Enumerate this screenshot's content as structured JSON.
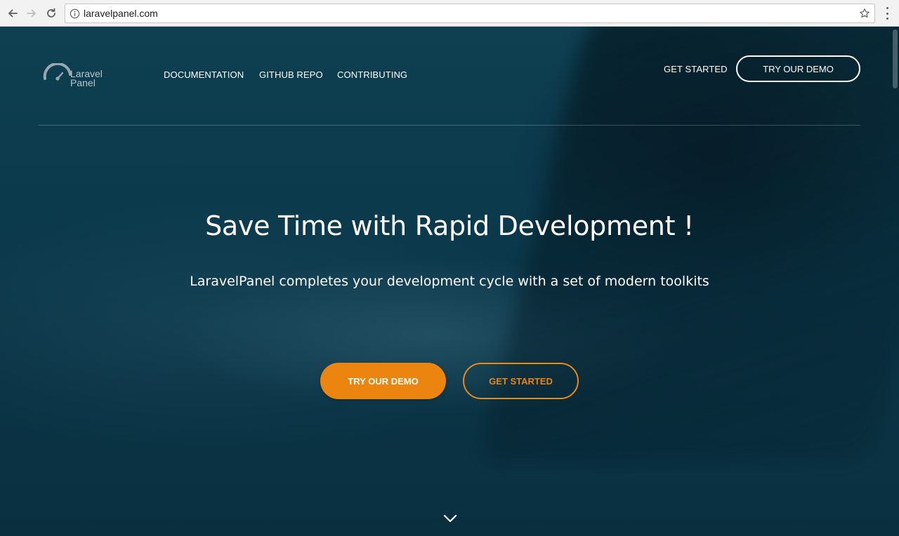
{
  "browser": {
    "url": "laravelpanel.com",
    "icons": [
      "back-arrow-icon",
      "forward-arrow-icon",
      "reload-icon",
      "info-icon",
      "star-icon",
      "menu-dots-icon"
    ]
  },
  "header": {
    "logo": {
      "line1": "Laravel",
      "line2": "Panel",
      "icon": "gauge-icon"
    },
    "nav": [
      {
        "label": "DOCUMENTATION"
      },
      {
        "label": "GITHUB REPO"
      },
      {
        "label": "CONTRIBUTING"
      }
    ],
    "get_started_label": "GET STARTED",
    "try_demo_label": "TRY OUR DEMO"
  },
  "hero": {
    "headline": "Save Time with Rapid Development !",
    "subheadline": "LaravelPanel completes your development cycle with a set of modern toolkits",
    "primary_button": "TRY OUR DEMO",
    "secondary_button": "GET STARTED",
    "scroll_icon": "chevron-down-icon"
  },
  "colors": {
    "accent": "#ec8510",
    "hero_background": "#0b3a4c",
    "text": "#ffffff"
  }
}
